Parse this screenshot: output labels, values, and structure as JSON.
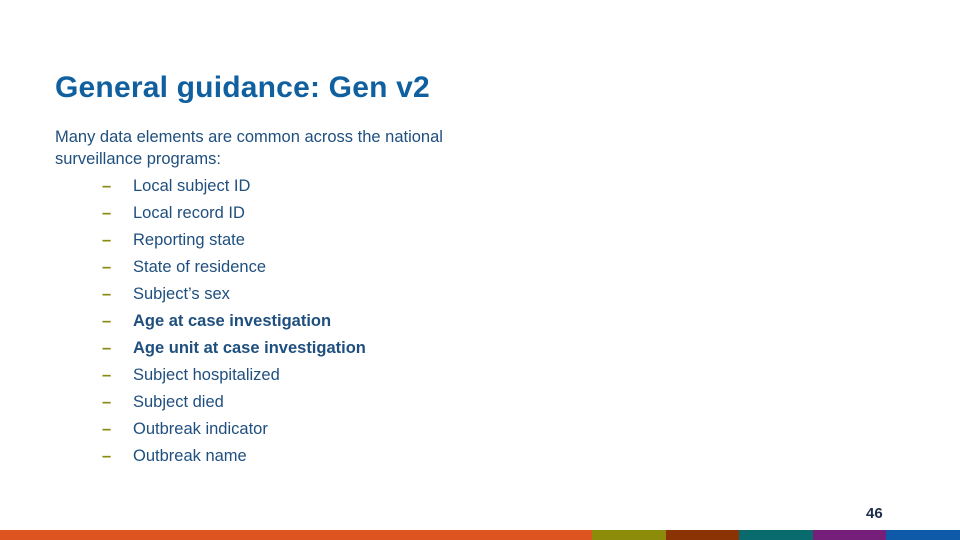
{
  "slide": {
    "title": "General guidance: Gen v2",
    "intro": "Many data elements are common across the national surveillance programs:",
    "bullet_glyph": "–",
    "items": [
      {
        "label": "Local subject ID",
        "bold": false
      },
      {
        "label": "Local record ID",
        "bold": false
      },
      {
        "label": "Reporting state",
        "bold": false
      },
      {
        "label": "State of residence",
        "bold": false
      },
      {
        "label": "Subject’s sex",
        "bold": false
      },
      {
        "label": "Age at case investigation",
        "bold": true
      },
      {
        "label": "Age unit at case investigation",
        "bold": true
      },
      {
        "label": "Subject hospitalized",
        "bold": false
      },
      {
        "label": "Subject died",
        "bold": false
      },
      {
        "label": "Outbreak indicator",
        "bold": false
      },
      {
        "label": "Outbreak name",
        "bold": false
      }
    ],
    "page_number": "46"
  },
  "footer_bar": {
    "colors": [
      "#dd5420",
      "#8c8c0a",
      "#8b3305",
      "#0a6b6e",
      "#761f7a",
      "#0f5aa8"
    ]
  }
}
